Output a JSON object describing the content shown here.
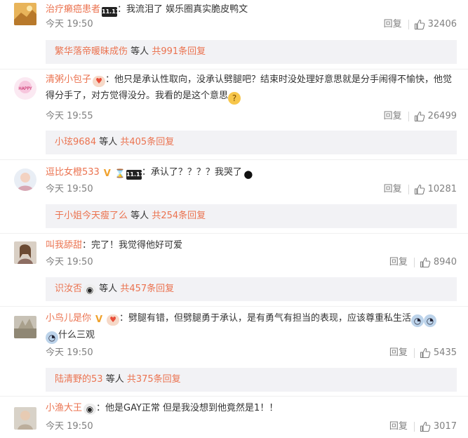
{
  "reply_label": "回复",
  "subreply_suffix": "等人",
  "comments": [
    {
      "username": "治疗癞癌患者",
      "badges": [
        "11.11"
      ],
      "text": "：我流泪了 娱乐圈真实脆皮鸭文",
      "time": "今天 19:50",
      "likes": "32406",
      "sub_name": "繁华落帝暖昧成伤",
      "sub_count": "共991条回复"
    },
    {
      "username": "清粥小包子",
      "badges": [
        "heart"
      ],
      "text": "：他只是承认性取向，没承认劈腿吧？结束时没处理好意思就是分手闹得不愉快，他觉得分手了，对方觉得没分。我看的是这个意思",
      "time": "今天 19:55",
      "likes": "26499",
      "sub_name": "小玹9684",
      "sub_count": "共405条回复"
    },
    {
      "username": "逗比女橙533",
      "badges": [
        "V",
        "hourglass",
        "11.11"
      ],
      "text": "：承认了？？？？我哭了",
      "time": "今天 19:50",
      "likes": "10281",
      "sub_name": "于小姐今天瘦了么",
      "sub_count": "共254条回复"
    },
    {
      "username": "叫我舔甜",
      "badges": [],
      "text": "：完了！我觉得他好可爱",
      "time": "今天 19:50",
      "likes": "8940",
      "sub_name": "识汝否",
      "sub_count": "共457条回复"
    },
    {
      "username": "小鸟儿是你",
      "badges": [
        "V",
        "heart"
      ],
      "text": "：劈腿有错，但劈腿勇于承认，是有勇气有担当的表现，应该尊重私生活",
      "text2": "什么三观",
      "time": "今天 19:50",
      "likes": "5435",
      "sub_name": "陆清野的53",
      "sub_count": "共375条回复"
    },
    {
      "username": "小渔大王",
      "badges": [
        "panda"
      ],
      "text": "：他是GAY正常 但是我没想到他竟然是1！！",
      "time": "今天 19:50",
      "likes": "3017"
    }
  ]
}
